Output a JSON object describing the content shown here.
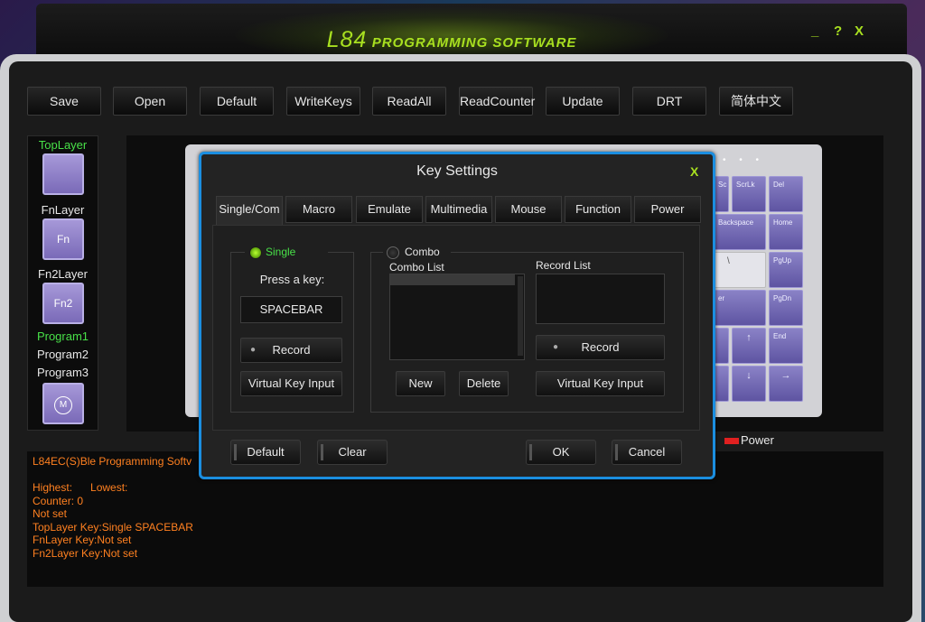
{
  "app": {
    "title_main": "L84",
    "title_sub": "PROGRAMMING SOFTWARE",
    "window_controls": [
      "_",
      "?",
      "X"
    ]
  },
  "toolbar": [
    "Save",
    "Open",
    "Default",
    "WriteKeys",
    "ReadAll",
    "ReadCounter",
    "Update",
    "DRT",
    "简体中文"
  ],
  "layers": {
    "top_layer": "TopLayer",
    "fn_layer": "FnLayer",
    "fn_key": "Fn",
    "fn2_layer": "Fn2Layer",
    "fn2_key": "Fn2",
    "program1": "Program1",
    "program2": "Program2",
    "program3": "Program3",
    "m_key": "M"
  },
  "keyboard": {
    "keys": [
      "Sc",
      "ScrLk",
      "Del",
      "Backspace",
      "Home",
      "\\",
      "PgUp",
      "er",
      "PgDn",
      "↑",
      "End",
      "↓",
      "→"
    ]
  },
  "legend": {
    "power": "Power"
  },
  "log": [
    "L84EC(S)Ble Programming Softv",
    "Highest:      Lowest:",
    "Counter: 0",
    "Not set",
    "TopLayer Key:Single SPACEBAR",
    "FnLayer Key:Not set",
    "Fn2Layer Key:Not set"
  ],
  "dialog": {
    "title": "Key Settings",
    "close": "X",
    "tabs": [
      "Single/Com",
      "Macro",
      "Emulate",
      "Multimedia",
      "Mouse",
      "Function",
      "Power"
    ],
    "single": {
      "label": "Single",
      "prompt": "Press a key:",
      "key_value": "SPACEBAR",
      "record": "Record",
      "virtual": "Virtual Key Input"
    },
    "combo": {
      "label": "Combo",
      "combo_list": "Combo List",
      "record_list": "Record List",
      "new": "New",
      "delete": "Delete",
      "record": "Record",
      "virtual": "Virtual Key Input"
    },
    "buttons": {
      "default": "Default",
      "clear": "Clear",
      "ok": "OK",
      "cancel": "Cancel"
    }
  },
  "colors": {
    "accent_green": "#a8e020",
    "active_green": "#48e048",
    "log_orange": "#ff8020",
    "dialog_border": "#1b8ee0",
    "key_purple": "#8a82c6"
  }
}
